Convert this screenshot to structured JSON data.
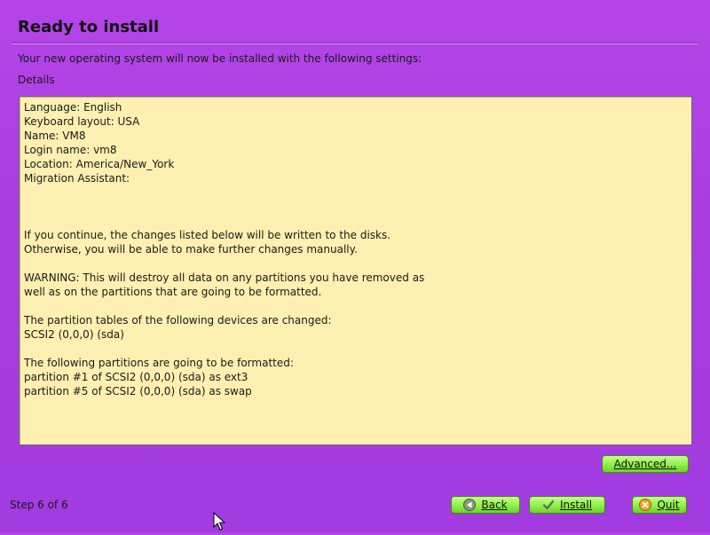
{
  "page": {
    "title": "Ready to install",
    "subtitle": "Your new operating system will now be installed with the following settings:",
    "details_label": "Details"
  },
  "details": {
    "lines": [
      "Language: English",
      "Keyboard layout: USA",
      "Name: VM8",
      "Login name: vm8",
      "Location: America/New_York",
      "Migration Assistant:",
      "",
      "",
      "",
      "If you continue, the changes listed below will be written to the disks.",
      "Otherwise, you will be able to make further changes manually.",
      "",
      "WARNING: This will destroy all data on any partitions you have removed as",
      "well as on the partitions that are going to be formatted.",
      "",
      "The partition tables of the following devices are changed:",
      "SCSI2 (0,0,0) (sda)",
      "",
      "The following partitions are going to be formatted:",
      "partition #1 of SCSI2 (0,0,0) (sda) as ext3",
      "partition #5 of SCSI2 (0,0,0) (sda) as swap"
    ]
  },
  "buttons": {
    "advanced": "Advanced...",
    "back": "Back",
    "install": "Install",
    "quit": "Quit"
  },
  "icons": {
    "back": "arrow-left-icon",
    "install": "checkmark-icon",
    "quit": "close-circle-icon"
  },
  "footer": {
    "step": "Step 6 of 6"
  },
  "colors": {
    "background": "#a83ee0",
    "details_bg": "#fdf0b0",
    "button_green": "#8ef04a"
  }
}
